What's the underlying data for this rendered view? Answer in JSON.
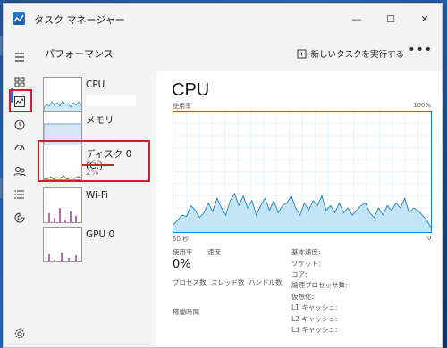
{
  "window": {
    "title": "タスク マネージャー"
  },
  "header": {
    "page_title": "パフォーマンス",
    "run_task_label": "新しいタスクを実行する",
    "more_label": "•••"
  },
  "sidebar": {
    "items": [
      {
        "name": "CPU",
        "sub": ""
      },
      {
        "name": "メモリ",
        "sub": ""
      },
      {
        "name": "ディスク 0 (C:)",
        "sub": "SSD",
        "sub2": "2%"
      },
      {
        "name": "Wi-Fi",
        "sub": ""
      },
      {
        "name": "GPU 0",
        "sub": ""
      }
    ]
  },
  "main": {
    "title": "CPU",
    "graph": {
      "top_left": "使用率",
      "top_right": "100%",
      "bottom_left": "60 秒",
      "bottom_right": "0"
    },
    "stats": {
      "usage_label": "使用率",
      "speed_label": "速度",
      "usage_value": "0%",
      "process_label": "プロセス数",
      "thread_label": "スレッド数",
      "handle_label": "ハンドル数",
      "uptime_label": "稼働時間"
    },
    "specs": [
      "基本速度:",
      "ソケット:",
      "コア:",
      "論理プロセッサ数:",
      "仮想化:",
      "L1 キャッシュ:",
      "L2 キャッシュ:",
      "L3 キャッシュ:"
    ]
  },
  "chart_data": {
    "type": "area",
    "x_label": "",
    "ylim": [
      0,
      100
    ],
    "values": [
      6,
      10,
      14,
      13,
      22,
      18,
      12,
      16,
      24,
      17,
      28,
      20,
      14,
      26,
      32,
      22,
      30,
      20,
      26,
      14,
      22,
      28,
      18,
      26,
      16,
      22,
      24,
      30,
      20,
      14,
      24,
      18,
      26,
      22,
      30,
      18,
      22,
      16,
      24,
      16,
      20,
      14,
      18,
      22,
      24,
      16,
      12,
      20,
      14,
      22,
      18,
      24,
      20,
      28,
      16,
      20,
      18,
      14,
      10,
      4
    ]
  },
  "colors": {
    "accent": "#2b6fc9",
    "graph_line": "#1b7fc3",
    "graph_fill": "#c4e5f6",
    "highlight": "#d21f2a"
  }
}
